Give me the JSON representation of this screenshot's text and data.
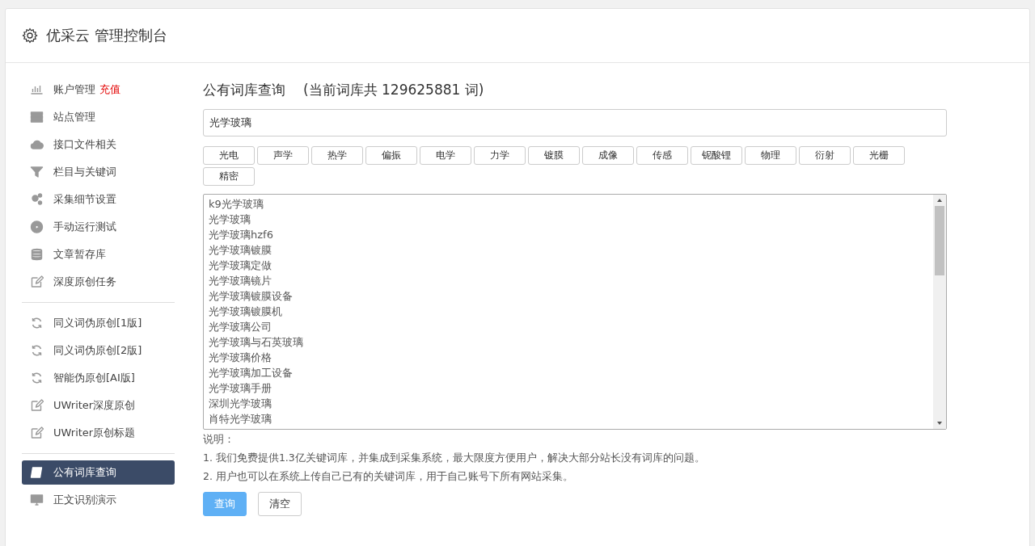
{
  "header": {
    "title": "优采云 管理控制台"
  },
  "sidebar": {
    "groups": [
      {
        "items": [
          {
            "label": "账户管理",
            "badge": "充值",
            "selected": false
          },
          {
            "label": "站点管理",
            "selected": false
          },
          {
            "label": "接口文件相关",
            "selected": false
          },
          {
            "label": "栏目与关键词",
            "selected": false
          },
          {
            "label": "采集细节设置",
            "selected": false
          },
          {
            "label": "手动运行测试",
            "selected": false
          },
          {
            "label": "文章暂存库",
            "selected": false
          },
          {
            "label": "深度原创任务",
            "selected": false
          }
        ]
      },
      {
        "items": [
          {
            "label": "同义词伪原创[1版]",
            "selected": false
          },
          {
            "label": "同义词伪原创[2版]",
            "selected": false
          },
          {
            "label": "智能伪原创[AI版]",
            "selected": false
          },
          {
            "label": "UWriter深度原创",
            "selected": false
          },
          {
            "label": "UWriter原创标题",
            "selected": false
          }
        ]
      },
      {
        "items": [
          {
            "label": "公有词库查询",
            "selected": true
          },
          {
            "label": "正文识别演示",
            "selected": false
          }
        ]
      }
    ]
  },
  "main": {
    "title": "公有词库查询",
    "subtitle": "(当前词库共 129625881 词)",
    "search": {
      "value": "光学玻璃"
    },
    "tags": [
      "光电",
      "声学",
      "热学",
      "偏振",
      "电学",
      "力学",
      "镀膜",
      "成像",
      "传感",
      "铌酸锂",
      "物理",
      "衍射",
      "光栅",
      "精密"
    ],
    "results": [
      "k9光学玻璃",
      "光学玻璃",
      "光学玻璃hzf6",
      "光学玻璃镀膜",
      "光学玻璃定做",
      "光学玻璃镜片",
      "光学玻璃镀膜设备",
      "光学玻璃镀膜机",
      "光学玻璃公司",
      "光学玻璃与石英玻璃",
      "光学玻璃价格",
      "光学玻璃加工设备",
      "光学玻璃手册",
      "深圳光学玻璃",
      "肖特光学玻璃"
    ],
    "notes_title": "说明：",
    "notes": [
      "1. 我们免费提供1.3亿关键词库，并集成到采集系统，最大限度方便用户，解决大部分站长没有词库的问题。",
      "2. 用户也可以在系统上传自己已有的关键词库，用于自己账号下所有网站采集。"
    ],
    "buttons": [
      {
        "label": "查询",
        "kind": "primary"
      },
      {
        "label": "清空",
        "kind": "default"
      }
    ]
  }
}
